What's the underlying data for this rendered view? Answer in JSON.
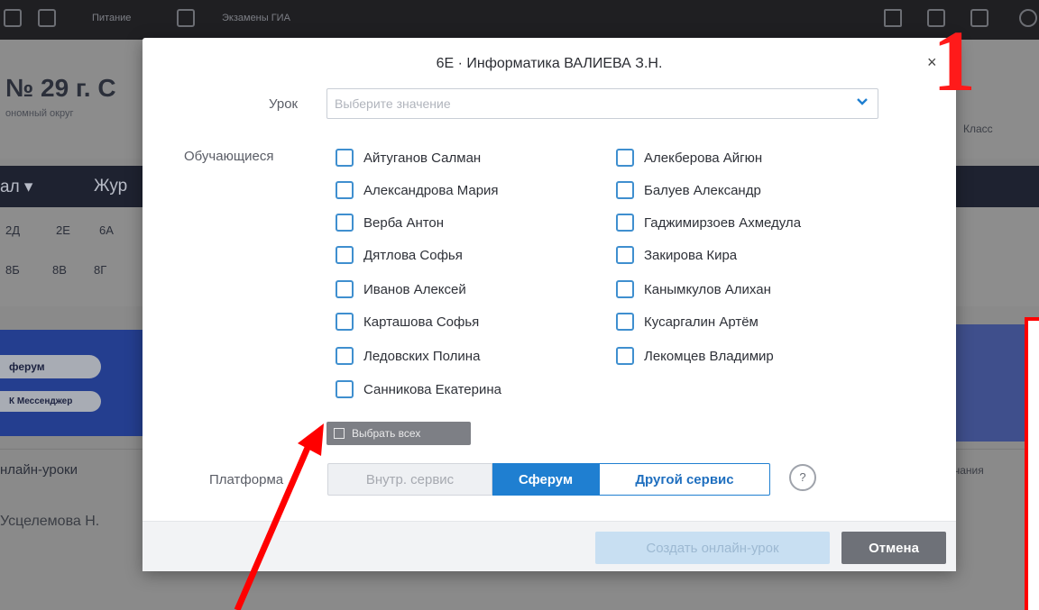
{
  "background": {
    "topbar": {
      "items": [
        "Питание",
        "Экзамены ГИА"
      ]
    },
    "school": {
      "title": "№ 29 г. С",
      "subtitle": "ономный округ",
      "klass_label": "Класс"
    },
    "nav": {
      "items": [
        "ал ▾",
        "Жур"
      ]
    },
    "class_chips": {
      "row1": [
        "2Д",
        "2Е",
        "6А"
      ],
      "row2": [
        "8Б",
        "8В",
        "8Г"
      ]
    },
    "banner": {
      "pills": [
        "ферум",
        "К Мессенджер"
      ]
    },
    "tabs": {
      "left": "нлайн-уроки",
      "right": "чания"
    },
    "teacher": "Усцелемова Н."
  },
  "modal": {
    "title": "6Е · Информатика ВАЛИЕВА З.Н.",
    "close_symbol": "×",
    "lesson_label": "Урок",
    "lesson_placeholder": "Выберите значение",
    "students_label": "Обучающиеся",
    "students_col1": [
      "Айтуганов Салман",
      "Александрова Мария",
      "Верба Антон",
      "Дятлова Софья",
      "Иванов Алексей",
      "Карташова Софья",
      "Ледовских Полина",
      "Санникова Екатерина"
    ],
    "students_col2": [
      "Алекберова Айгюн",
      "Балуев Александр",
      "Гаджимирзоев Ахмедула",
      "Закирова Кира",
      "Канымкулов Алихан",
      "Кусаргалин Артём",
      "Лекомцев Владимир"
    ],
    "select_all": "Выбрать всех",
    "platform_label": "Платформа",
    "platform_options": [
      "Внутр. сервис",
      "Сферум",
      "Другой сервис"
    ],
    "platform_selected": "Сферум",
    "help_symbol": "?",
    "create_button": "Создать онлайн-урок",
    "cancel_button": "Отмена"
  },
  "annotations": {
    "step_number": "1"
  },
  "colors": {
    "accent": "#1f7fd1",
    "checkbox_border": "#3f8fcf",
    "annotation": "#ff0000"
  }
}
